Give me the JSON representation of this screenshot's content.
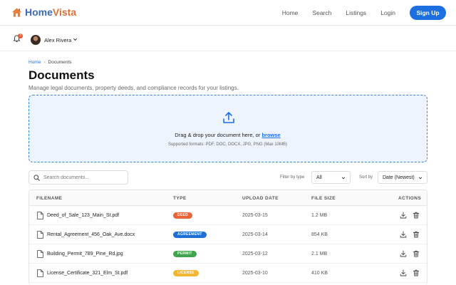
{
  "brand": {
    "name_part1": "Home",
    "name_part2": "Vista"
  },
  "nav": {
    "links": [
      "Home",
      "Search",
      "Listings",
      "Login"
    ],
    "signup_label": "Sign Up"
  },
  "user": {
    "name": "Alex Rivera",
    "notification_count": "3"
  },
  "breadcrumb": {
    "home": "Home",
    "separator": "›",
    "current": "Documents"
  },
  "page": {
    "title": "Documents",
    "subtitle": "Manage legal documents, property deeds, and compliance records for your listings."
  },
  "upload": {
    "text_prefix": "Drag & drop your document here, or ",
    "browse_label": "browse",
    "hint": "Supported formats: PDF, DOC, DOCX, JPG, PNG (Max 10MB)"
  },
  "toolbar": {
    "search_placeholder": "Search documents...",
    "filter_label": "Filter by type",
    "filter_value": "All",
    "sort_label": "Sort by",
    "sort_value": "Date (Newest)"
  },
  "table": {
    "headers": {
      "filename": "FILENAME",
      "type": "TYPE",
      "upload_date": "UPLOAD DATE",
      "file_size": "FILE SIZE",
      "actions": "ACTIONS"
    },
    "rows": [
      {
        "filename": "Deed_of_Sale_123_Main_St.pdf",
        "type": "DEED",
        "type_color": "#e8643a",
        "date": "2025-03-15",
        "size": "1.2 MB"
      },
      {
        "filename": "Rental_Agreement_456_Oak_Ave.docx",
        "type": "AGREEMENT",
        "type_color": "#1d6fd6",
        "date": "2025-03-14",
        "size": "854 KB"
      },
      {
        "filename": "Building_Permit_789_Pine_Rd.jpg",
        "type": "PERMIT",
        "type_color": "#3fa34d",
        "date": "2025-03-12",
        "size": "2.1 MB"
      },
      {
        "filename": "License_Certificate_321_Elm_St.pdf",
        "type": "LICENSE",
        "type_color": "#f2b632",
        "date": "2025-03-10",
        "size": "410 KB"
      }
    ]
  },
  "colors": {
    "primary": "#1d6fe0",
    "brand_blue": "#3e6bb8",
    "brand_orange": "#d4703a",
    "dropzone_bg": "#eef4fd",
    "dropzone_border": "#3b86d8"
  },
  "icons": {
    "logo": "house-icon",
    "notifications": "bell-icon",
    "user_menu": "chevron-down-icon",
    "upload": "upload-icon",
    "search": "search-icon",
    "file": "file-icon",
    "download": "download-icon",
    "delete": "trash-icon"
  }
}
